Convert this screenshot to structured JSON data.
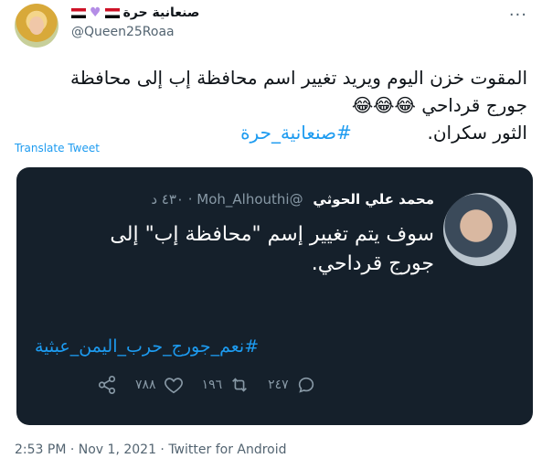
{
  "author": {
    "display_name": "صنعانية حرة",
    "handle": "@Queen25Roaa",
    "name_icons": [
      "yemen-flag",
      "purple-heart",
      "yemen-flag"
    ]
  },
  "tweet": {
    "line1": "المقوت خزن اليوم ويريد تغيير اسم محافظة  إب إلى محافظة",
    "line2": "جورج قرداحي 😂😂😂",
    "line3": "الثور سكران.",
    "hashtag": "#صنعانية_حرة",
    "translate_label": "Translate Tweet"
  },
  "embedded": {
    "name": "محمد علي الحوثي",
    "handle": "@Moh_Alhouthi",
    "time": "٤٣٠ د",
    "text_line1": "سوف يتم تغيير إسم \"محافظة إب\" إلى",
    "text_line2": "جورج قرداحي.",
    "hashtag": "#نعم_جورج_حرب_اليمن_عبثية",
    "likes": "٧٨٨",
    "retweets": "١٩٦",
    "replies": "٢٤٧"
  },
  "footer": {
    "timestamp": "2:53 PM · Nov 1, 2021 · Twitter for Android"
  }
}
